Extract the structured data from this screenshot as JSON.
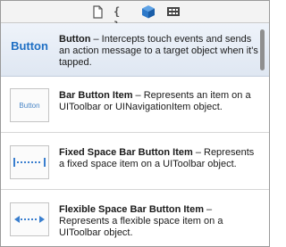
{
  "tabs": [
    {
      "name": "file-template-library",
      "icon": "document-icon"
    },
    {
      "name": "code-snippet-library",
      "icon": "braces-icon",
      "label": "{ }"
    },
    {
      "name": "object-library",
      "icon": "cube-icon",
      "active": true
    },
    {
      "name": "media-library",
      "icon": "film-icon"
    }
  ],
  "items": [
    {
      "thumb_label": "Button",
      "title": "Button",
      "separator": " – ",
      "description": "Intercepts touch events and sends an action message to a target object when it's tapped."
    },
    {
      "thumb_label": "Button",
      "title": "Bar Button Item",
      "separator": " – ",
      "description": "Represents an item on a UIToolbar or UINavigationItem object."
    },
    {
      "title": "Fixed Space Bar Button Item",
      "separator": " – ",
      "description": "Represents a fixed space item on a UIToolbar object."
    },
    {
      "title": "Flexible Space Bar Button Item",
      "separator": " – ",
      "description": "Represents a flexible space item on a UIToolbar object."
    }
  ],
  "colors": {
    "accent": "#1e6fc4",
    "thumb_accent": "#4a86c6",
    "selected_bg": "#e4ebf5"
  }
}
